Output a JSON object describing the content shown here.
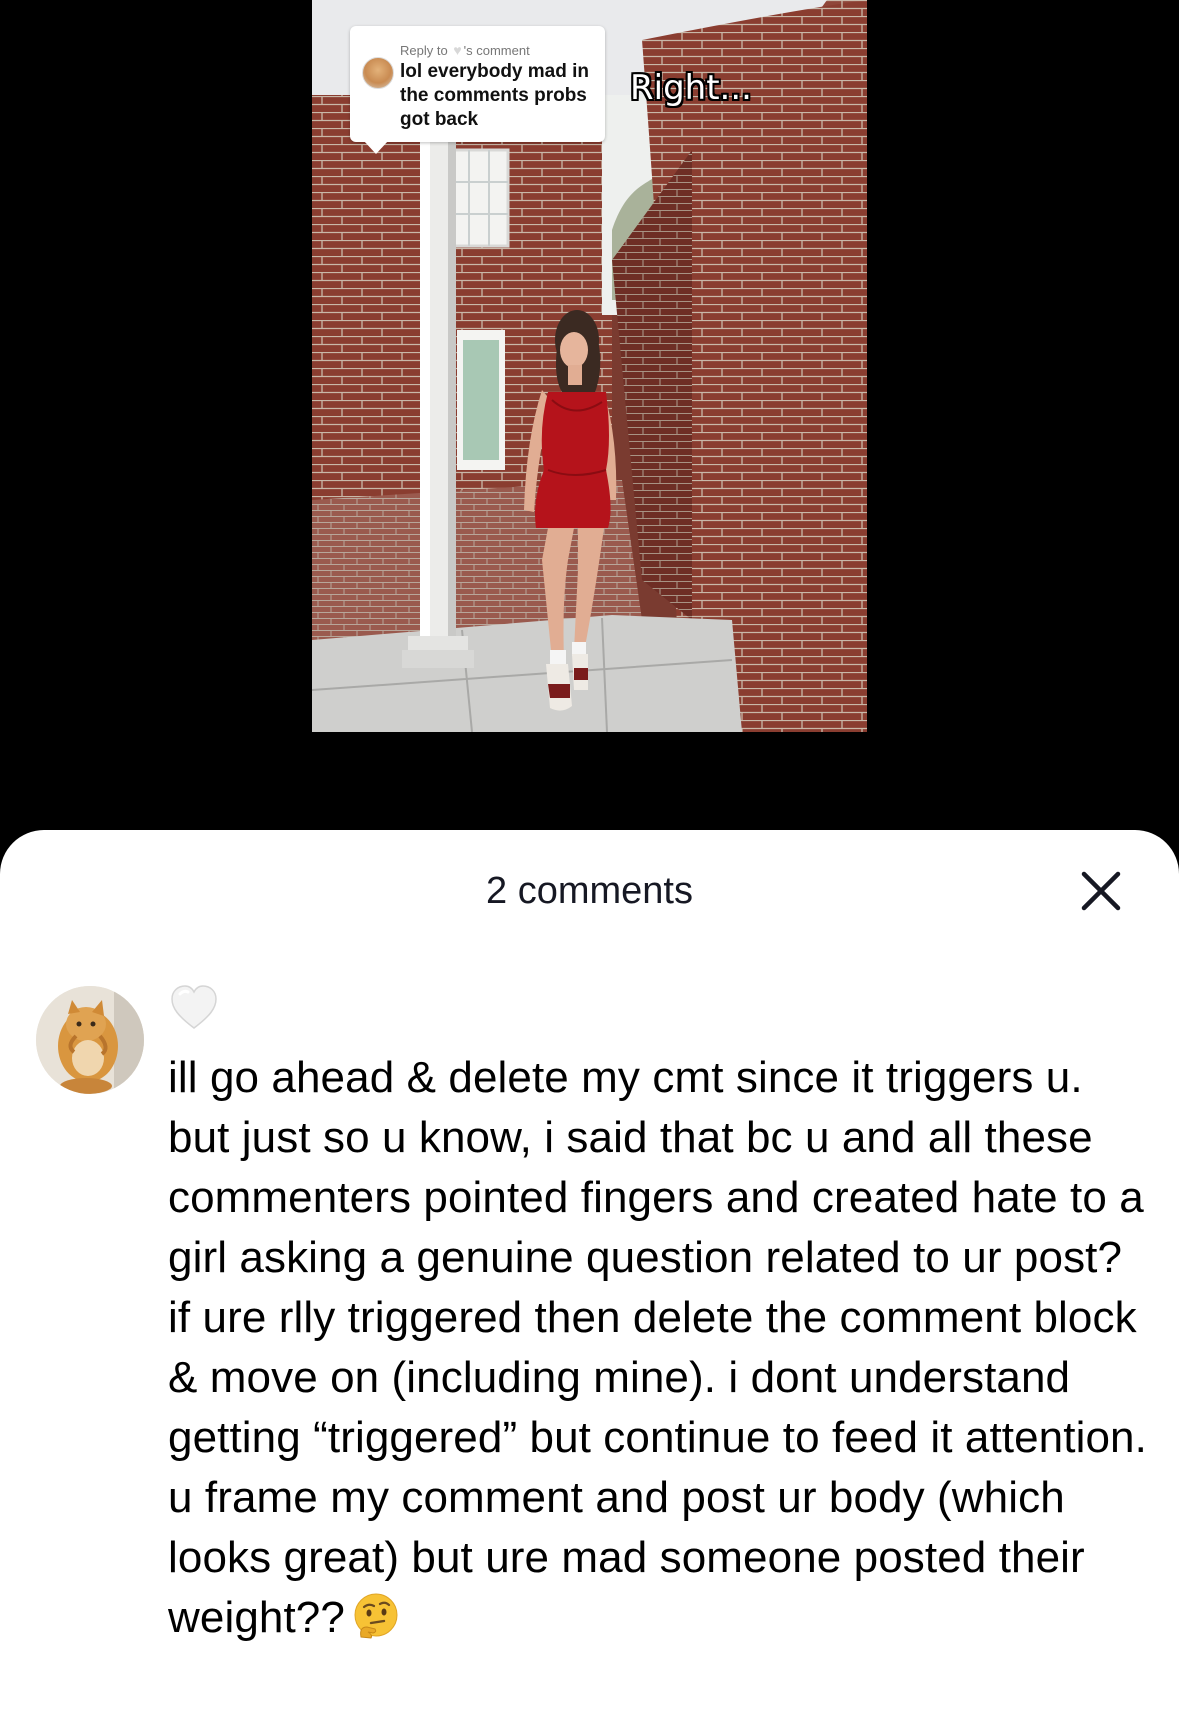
{
  "video": {
    "reply_bubble": {
      "header_prefix": "Reply to",
      "header_suffix": "'s comment",
      "heart_glyph": "♥",
      "text": "lol everybody mad in the comments probs got back"
    },
    "overlay_caption": "Right..."
  },
  "comments_panel": {
    "title": "2 comments",
    "close_icon": "close-icon",
    "comment": {
      "username_icon": "white-heart-icon",
      "body": "ill go ahead & delete my cmt since it triggers u. but just so u know, i said that bc u and all these commenters pointed fingers and created hate to a girl asking a genuine question related to ur post? if ure rlly triggered then delete the comment block & move on (including mine). i dont understand getting “triggered” but continue to feed it attention. u frame my comment and post ur body (which looks great) but ure mad someone posted their weight??",
      "trailing_emoji": "thinking-face-emoji"
    }
  },
  "colors": {
    "sheet_background": "#ffffff",
    "page_background": "#000000",
    "brick": "#8a3d30",
    "dress": "#b5131b"
  }
}
